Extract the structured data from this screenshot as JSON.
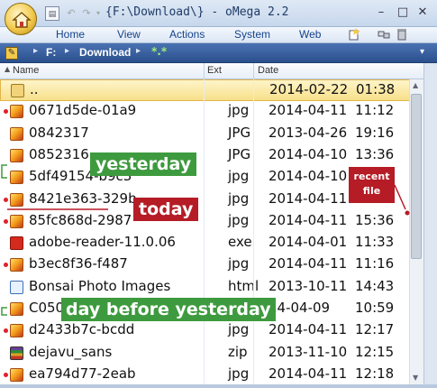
{
  "window": {
    "title": "{F:\\Download\\} - oMega 2.2"
  },
  "controls": {
    "minimize": "–",
    "maximize": "□",
    "close": "✕",
    "qa_menu": "▤",
    "undo": "↶",
    "redo": "↷",
    "qa_drop": "▾"
  },
  "menu": {
    "home": "Home",
    "view": "View",
    "actions": "Actions",
    "system": "System",
    "web": "Web"
  },
  "menubar_icons": [
    "new-icon",
    "tools-icon",
    "trash-icon"
  ],
  "address": {
    "edit_glyph": "✎",
    "separator": "▸",
    "drive": "F:",
    "folder": "Download",
    "filter": "*.*",
    "drop": "▾"
  },
  "columns": {
    "sort_glyph": "▲",
    "name": "Name",
    "ext": "Ext",
    "date": "Date"
  },
  "scroll": {
    "up": "▲",
    "down": "▼"
  },
  "files": [
    {
      "name": "..",
      "ext": "",
      "date": "2014-02-22",
      "time": "01:38",
      "icon": "folder-up-icon",
      "selected": true,
      "dot": false
    },
    {
      "name": "0671d5de-01a9",
      "ext": "jpg",
      "date": "2014-04-11",
      "time": "11:12",
      "icon": "image-icon",
      "dot": true
    },
    {
      "name": "0842317",
      "ext": "JPG",
      "date": "2013-04-26",
      "time": "19:16",
      "icon": "image-icon",
      "dot": false
    },
    {
      "name": "0852316",
      "ext": "JPG",
      "date": "2014-04-10",
      "time": "13:36",
      "icon": "image-icon",
      "dot": false
    },
    {
      "name": "5df49154-b9c3",
      "ext": "jpg",
      "date": "2014-04-10",
      "time": "",
      "icon": "image-icon",
      "dot": false
    },
    {
      "name": "8421e363-329b",
      "ext": "jpg",
      "date": "2014-04-11",
      "time": "",
      "icon": "image-icon",
      "dot": true
    },
    {
      "name": "85fc868d-2987",
      "ext": "jpg",
      "date": "2014-04-11",
      "time": "15:36",
      "icon": "image-icon",
      "dot": true
    },
    {
      "name": "adobe-reader-11.0.06",
      "ext": "exe",
      "date": "2014-04-01",
      "time": "11:33",
      "icon": "pdf-icon",
      "dot": false
    },
    {
      "name": "b3ec8f36-f487",
      "ext": "jpg",
      "date": "2014-04-11",
      "time": "11:16",
      "icon": "image-icon",
      "dot": true
    },
    {
      "name": "Bonsai Photo Images",
      "ext": "html",
      "date": "2013-10-11",
      "time": "14:43",
      "icon": "html-icon",
      "dot": false
    },
    {
      "name": "C0505",
      "ext": "",
      "date": "14-04-09",
      "time": "10:59",
      "icon": "image-icon",
      "dot": false
    },
    {
      "name": "d2433b7c-bcdd",
      "ext": "jpg",
      "date": "2014-04-11",
      "time": "12:17",
      "icon": "image-icon",
      "dot": true
    },
    {
      "name": "dejavu_sans",
      "ext": "zip",
      "date": "2013-11-10",
      "time": "12:15",
      "icon": "zip-icon",
      "dot": false
    },
    {
      "name": "ea794d77-2eab",
      "ext": "jpg",
      "date": "2014-04-11",
      "time": "12:18",
      "icon": "image-icon",
      "dot": true
    }
  ],
  "annotations": {
    "yesterday": "yesterday",
    "today": "today",
    "day_before_yesterday": "day before yesterday",
    "recent_file_line1": "recent",
    "recent_file_line2": "file"
  },
  "colors": {
    "accent_green": "#3e9a3e",
    "accent_red": "#b51c26",
    "selection": "#f8e08a",
    "address_bar": "#2b4f8d"
  }
}
